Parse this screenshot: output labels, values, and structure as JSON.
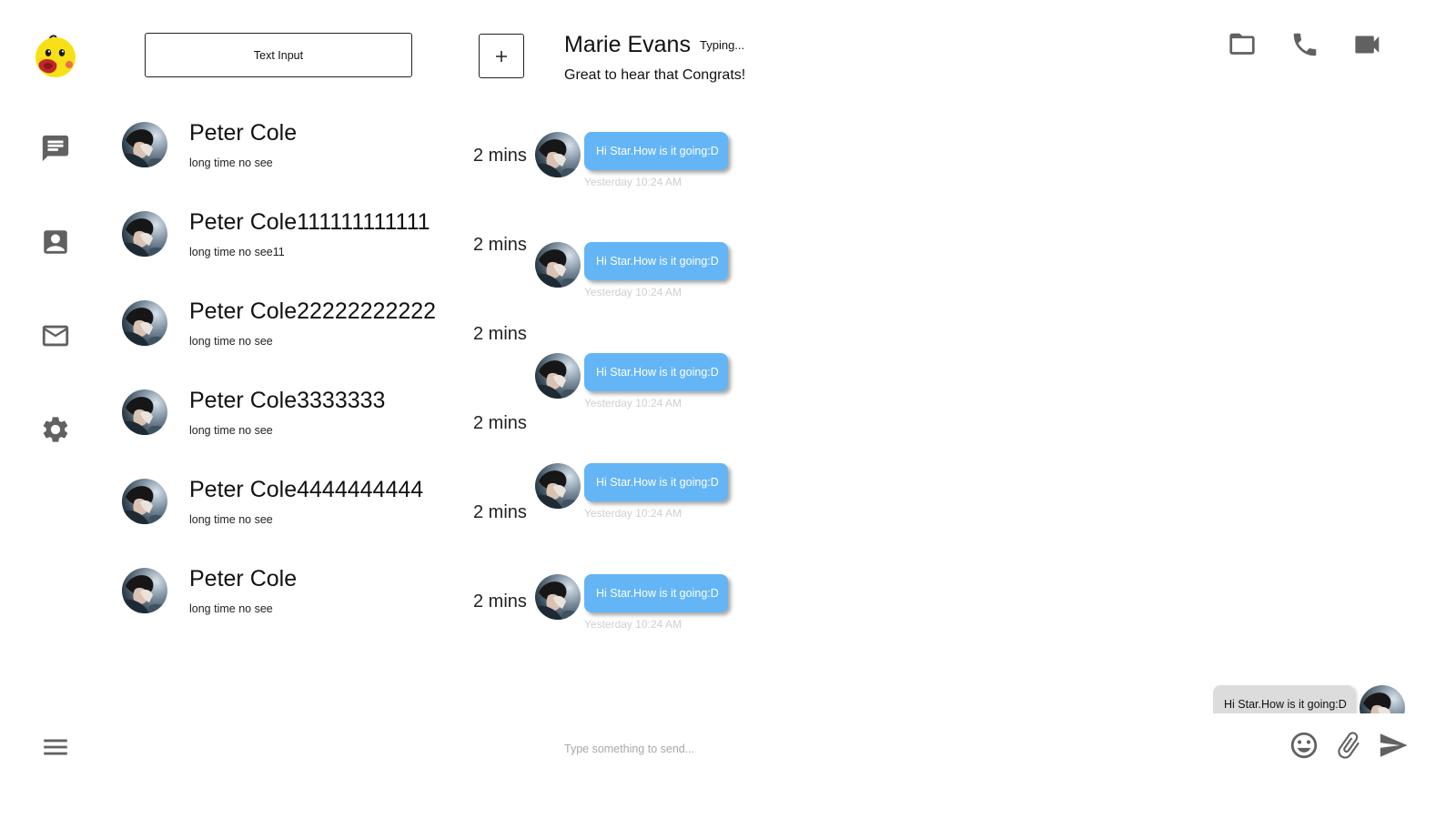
{
  "sidebar": {
    "logo": "duck-mascot-logo",
    "nav": [
      {
        "id": "messages",
        "icon": "chat-bubble-icon"
      },
      {
        "id": "contacts",
        "icon": "contact-card-icon"
      },
      {
        "id": "mail",
        "icon": "envelope-icon"
      },
      {
        "id": "settings",
        "icon": "gear-icon"
      }
    ],
    "menu_icon": "hamburger-menu-icon"
  },
  "search": {
    "value": "Text Input"
  },
  "add_button": {
    "icon": "plus-icon"
  },
  "conversations": [
    {
      "name": "Peter Cole",
      "preview": "long time no see",
      "time": "2 mins"
    },
    {
      "name": "Peter Cole111111111111",
      "preview": "long time no see11",
      "time": "2 mins"
    },
    {
      "name": "Peter Cole22222222222",
      "preview": "long time no see",
      "time": "2 mins"
    },
    {
      "name": "Peter Cole3333333",
      "preview": "long time no see",
      "time": "2 mins"
    },
    {
      "name": "Peter Cole4444444444",
      "preview": "long time no see",
      "time": "2 mins"
    },
    {
      "name": "Peter Cole",
      "preview": "long time no see",
      "time": "2 mins"
    }
  ],
  "chat": {
    "contact_name": "Marie Evans",
    "typing": "Typing...",
    "status": "Great to hear that Congrats!",
    "header_icons": [
      "folder-icon",
      "phone-icon",
      "video-camera-icon"
    ],
    "received": [
      {
        "text": "Hi Star.How is it going:D",
        "time": "Yesterday 10:24 AM"
      },
      {
        "text": "Hi Star.How is it going:D",
        "time": "Yesterday 10:24 AM"
      },
      {
        "text": "Hi Star.How is it going:D",
        "time": "Yesterday 10:24 AM"
      },
      {
        "text": "Hi Star.How is it going:D",
        "time": "Yesterday 10:24 AM"
      },
      {
        "text": "Hi Star.How is it going:D",
        "time": "Yesterday 10:24 AM"
      }
    ],
    "sent": [
      {
        "text": "Hi Star.How is it going:D"
      }
    ],
    "composer": {
      "placeholder": "Type something to send...",
      "icons": [
        "emoji-icon",
        "paperclip-icon",
        "send-icon"
      ]
    }
  },
  "colors": {
    "received_bubble": "#64b5f6",
    "sent_bubble": "#dcdcdc",
    "icon_gray": "#616161",
    "timestamp": "#cfcfcf"
  }
}
